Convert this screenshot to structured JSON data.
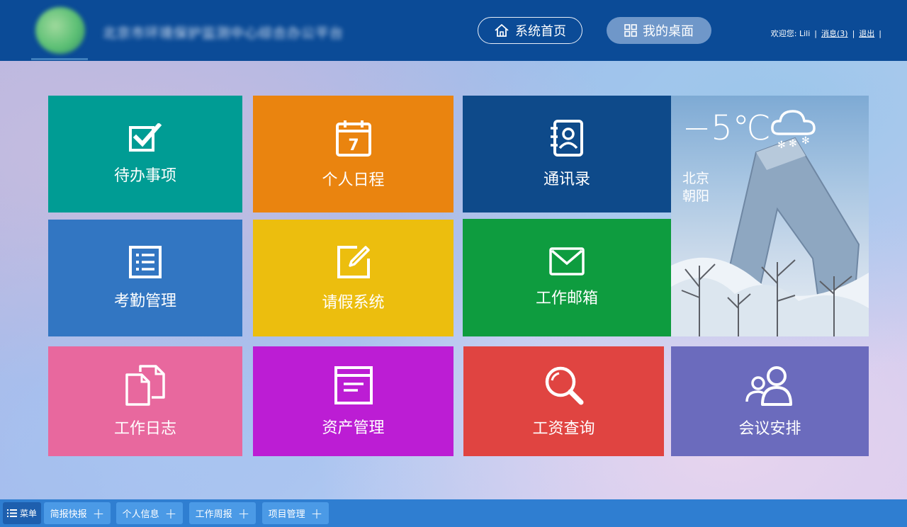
{
  "header": {
    "system_title": "北京市环境保护监测中心综合办公平台",
    "home_button": "系统首页",
    "desktop_button": "我的桌面",
    "welcome": "欢迎您: Lili",
    "messages_link": "消息(3)",
    "logout_link": "退出"
  },
  "tiles": [
    {
      "label": "待办事项",
      "icon": "checkbox-icon",
      "color": "#009c94"
    },
    {
      "label": "个人日程",
      "icon": "calendar-icon",
      "color": "#ea840f"
    },
    {
      "label": "通讯录",
      "icon": "contacts-icon",
      "color": "#0e4a8a"
    },
    {
      "label": "考勤管理",
      "icon": "list-icon",
      "color": "#3276c2"
    },
    {
      "label": "请假系统",
      "icon": "edit-icon",
      "color": "#ecbe0e"
    },
    {
      "label": "工作邮箱",
      "icon": "mail-icon",
      "color": "#0e9c3f"
    },
    {
      "label": "工作日志",
      "icon": "documents-icon",
      "color": "#e8689e"
    },
    {
      "label": "资产管理",
      "icon": "archive-icon",
      "color": "#bc1dd4"
    },
    {
      "label": "工资查询",
      "icon": "search-icon",
      "color": "#e04441"
    },
    {
      "label": "会议安排",
      "icon": "users-icon",
      "color": "#6b6bbd"
    }
  ],
  "calendar_day": "7",
  "weather": {
    "temperature": "−5℃",
    "city": "北京",
    "district": "朝阳",
    "icon": "snow-cloud-icon"
  },
  "taskbar": {
    "menu_label": "菜单",
    "tabs": [
      "简报快报",
      "个人信息",
      "工作周报",
      "项目管理"
    ]
  }
}
